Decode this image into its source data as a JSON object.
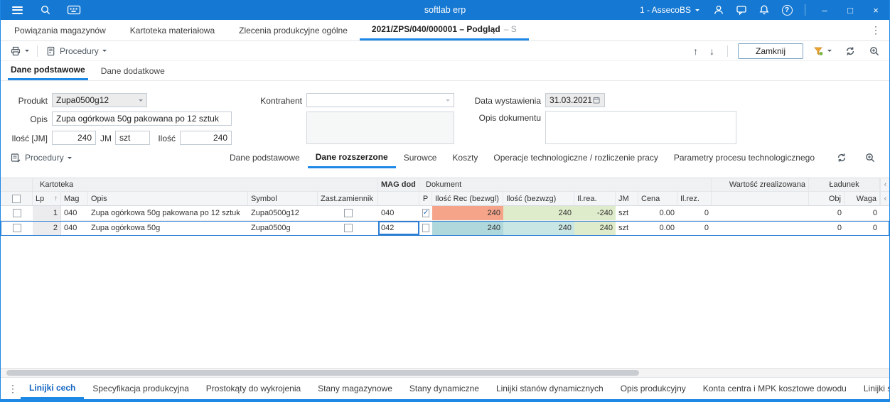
{
  "icons": {
    "caret": "▾",
    "up": "↑",
    "down": "↓",
    "sort": "↑",
    "dots": "⋮",
    "chev_left": "‹",
    "chev_right": "›",
    "minimize": "–",
    "maximize": "□",
    "close": "×",
    "help": "?",
    "check": "✓"
  },
  "colors": {
    "titlebar": "#1578d2",
    "accent": "#1e88e5",
    "selection": "#2a7cd4",
    "cell_salmon": "#f5a489",
    "cell_green": "#dfeccb",
    "cell_teal": "#aed8dc",
    "cell_teal_light": "#c8e6e3"
  },
  "titlebar": {
    "title": "softlab erp",
    "workspace": "1 - AssecoBS"
  },
  "main_tabs": {
    "items": [
      {
        "label": "Powiązania magazynów"
      },
      {
        "label": "Kartoteka materiałowa"
      },
      {
        "label": "Zlecenia produkcyjne ogólne"
      },
      {
        "label": "2021/ZPS/040/000001 – Podgląd",
        "suffix": "– S"
      }
    ]
  },
  "toolbar": {
    "procedury": "Procedury",
    "zamknij": "Zamknij"
  },
  "subtabs": {
    "items": [
      {
        "label": "Dane podstawowe"
      },
      {
        "label": "Dane dodatkowe"
      }
    ]
  },
  "form": {
    "produkt_label": "Produkt",
    "produkt_value": "Zupa0500g12",
    "opis_label": "Opis",
    "opis_value": "Zupa ogórkowa 50g pakowana po 12 sztuk",
    "ilosc_jm_label": "Ilość [JM]",
    "ilosc_jm_value": "240",
    "jm_label": "JM",
    "jm_value": "szt",
    "ilosc_label": "Ilość",
    "ilosc_value": "240",
    "kontrahent_label": "Kontrahent",
    "kontrahent_value": "",
    "kontrahent_notes": "",
    "data_label": "Data wystawienia",
    "data_value": "31.03.2021",
    "opis_dok_label": "Opis dokumentu",
    "opis_dok_value": ""
  },
  "grid_toolbar": {
    "procedury": "Procedury",
    "tabs": [
      {
        "label": "Dane podstawowe"
      },
      {
        "label": "Dane rozszerzone"
      },
      {
        "label": "Surowce"
      },
      {
        "label": "Koszty"
      },
      {
        "label": "Operacje technologiczne / rozliczenie pracy"
      },
      {
        "label": "Parametry procesu technologicznego"
      }
    ]
  },
  "grid": {
    "groups": {
      "kartoteka": "Kartoteka",
      "mag_dod": "MAG dod",
      "dokument": "Dokument",
      "wartosc": "Wartość zrealizowana",
      "ladunek": "Ładunek"
    },
    "columns": {
      "lp": "Lp",
      "mag": "Mag",
      "opis": "Opis",
      "symbol": "Symbol",
      "zast": "Zast.zamiennik",
      "p": "P",
      "rec": "Ilość Rec (bezwgl)",
      "bez": "Ilość (bezwzg)",
      "rea": "Il.rea.",
      "jm": "JM",
      "cena": "Cena",
      "rez": "Il.rez.",
      "obj": "Obj",
      "waga": "Waga"
    },
    "rows": [
      {
        "lp": "1",
        "mag": "040",
        "opis": "Zupa ogórkowa 50g pakowana po 12 sztuk",
        "symbol": "Zupa0500g12",
        "zast_mark": "",
        "mag_dod": "040",
        "p_mark": "✓",
        "rec": "240",
        "bez": "240",
        "rea": "-240",
        "jm": "szt",
        "cena": "0.00",
        "rez": "0",
        "wartosc": "",
        "obj": "0",
        "waga": "0"
      },
      {
        "lp": "2",
        "mag": "040",
        "opis": "Zupa ogórkowa 50g",
        "symbol": "Zupa0500g",
        "zast_mark": "",
        "mag_dod": "042",
        "p_mark": "",
        "rec": "240",
        "bez": "240",
        "rea": "240",
        "jm": "szt",
        "cena": "0.00",
        "rez": "0",
        "wartosc": "",
        "obj": "0",
        "waga": "0"
      }
    ]
  },
  "bottom_tabs": {
    "items": [
      {
        "label": "Linijki cech"
      },
      {
        "label": "Specyfikacja produkcyjna"
      },
      {
        "label": "Prostokąty do wykrojenia"
      },
      {
        "label": "Stany magazynowe"
      },
      {
        "label": "Stany dynamiczne"
      },
      {
        "label": "Linijki stanów dynamicznych"
      },
      {
        "label": "Opis produkcyjny"
      },
      {
        "label": "Konta centra i MPK kosztowe dowodu"
      },
      {
        "label": "Linijki st"
      }
    ]
  }
}
